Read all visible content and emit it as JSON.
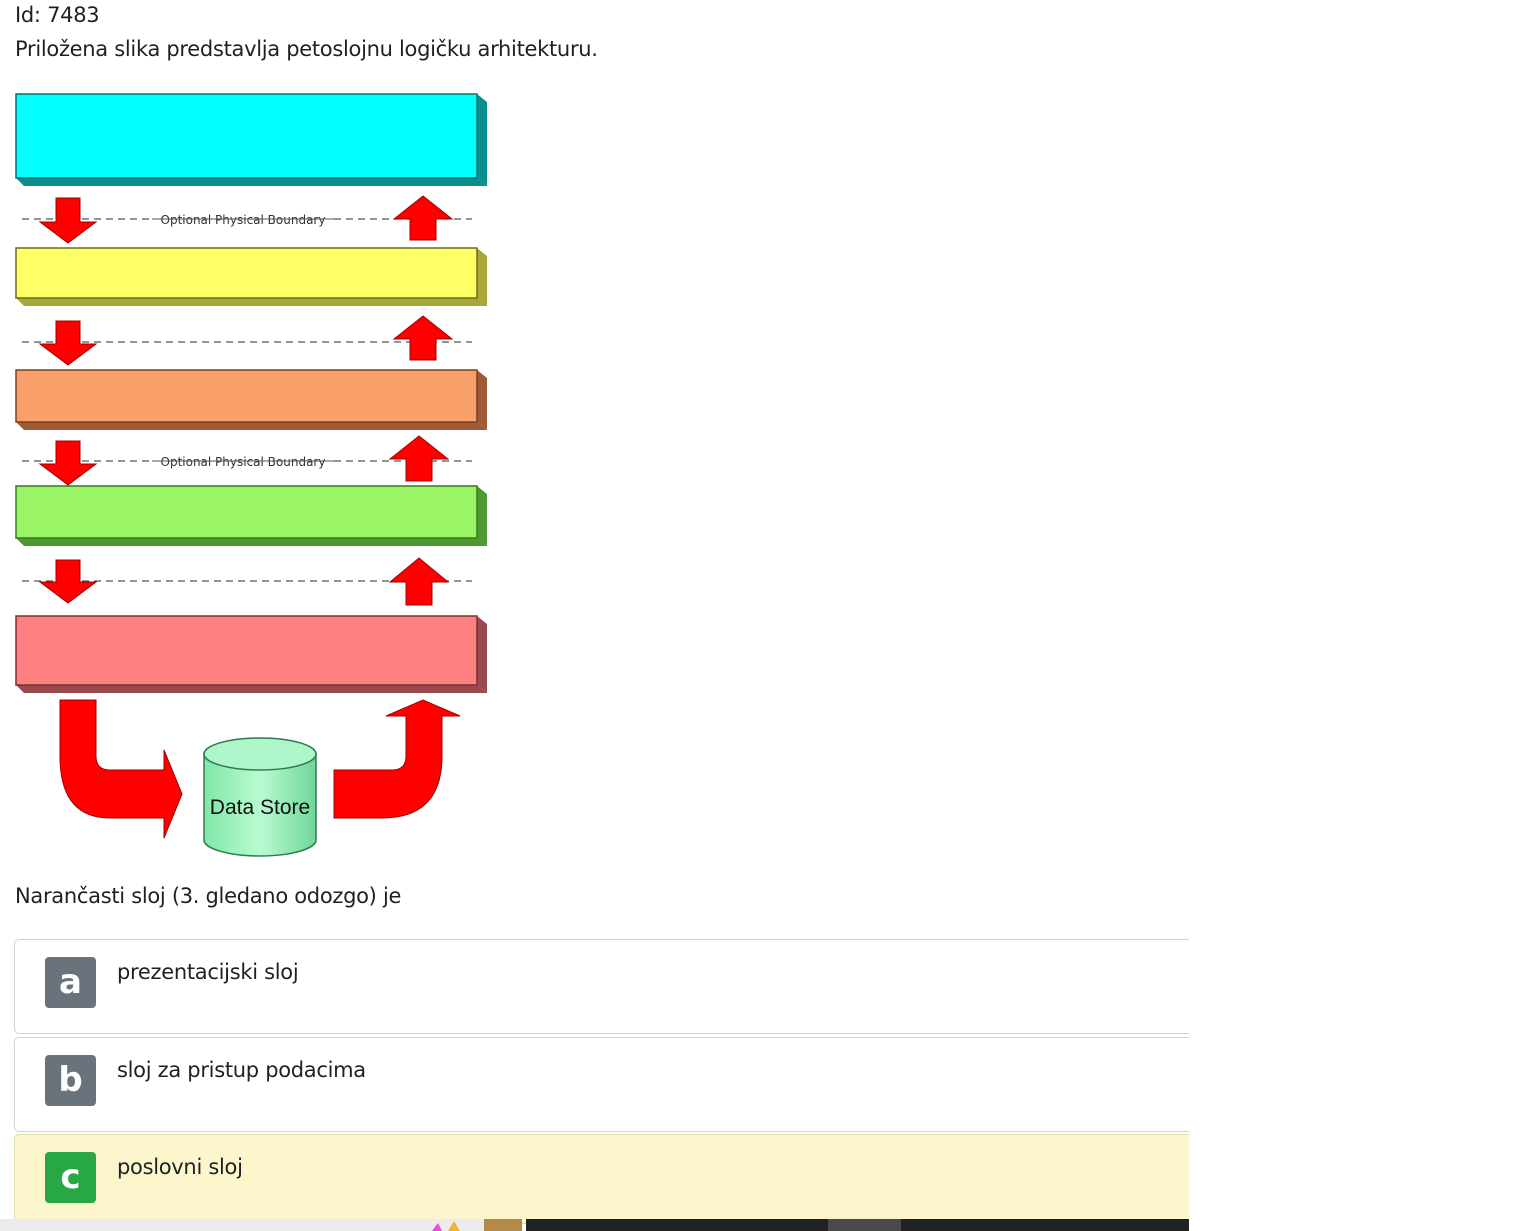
{
  "question": {
    "id_label": "Id: 7483",
    "text": "Priložena slika predstavlja petoslojnu logičku arhitekturu.",
    "prompt": "Narančasti sloj (3. gledano odozgo) je"
  },
  "figure": {
    "layer_colors": [
      "#00ffff",
      "#ffff66",
      "#f9a06a",
      "#99f566",
      "#ff8080"
    ],
    "boundary_label_1": "Optional Physical Boundary",
    "boundary_label_2": "Optional Physical Boundary",
    "data_store_label": "Data Store",
    "arrow_color": "#ff0000"
  },
  "answers": [
    {
      "letter": "a",
      "text": "prezentacijski sloj",
      "selected": false
    },
    {
      "letter": "b",
      "text": "sloj za pristup podacima",
      "selected": false
    },
    {
      "letter": "c",
      "text": "poslovni sloj",
      "selected": true
    }
  ],
  "colors": {
    "badge_default": "#6a737b",
    "badge_selected": "#28a745",
    "selected_bg": "#fdf6cd"
  }
}
